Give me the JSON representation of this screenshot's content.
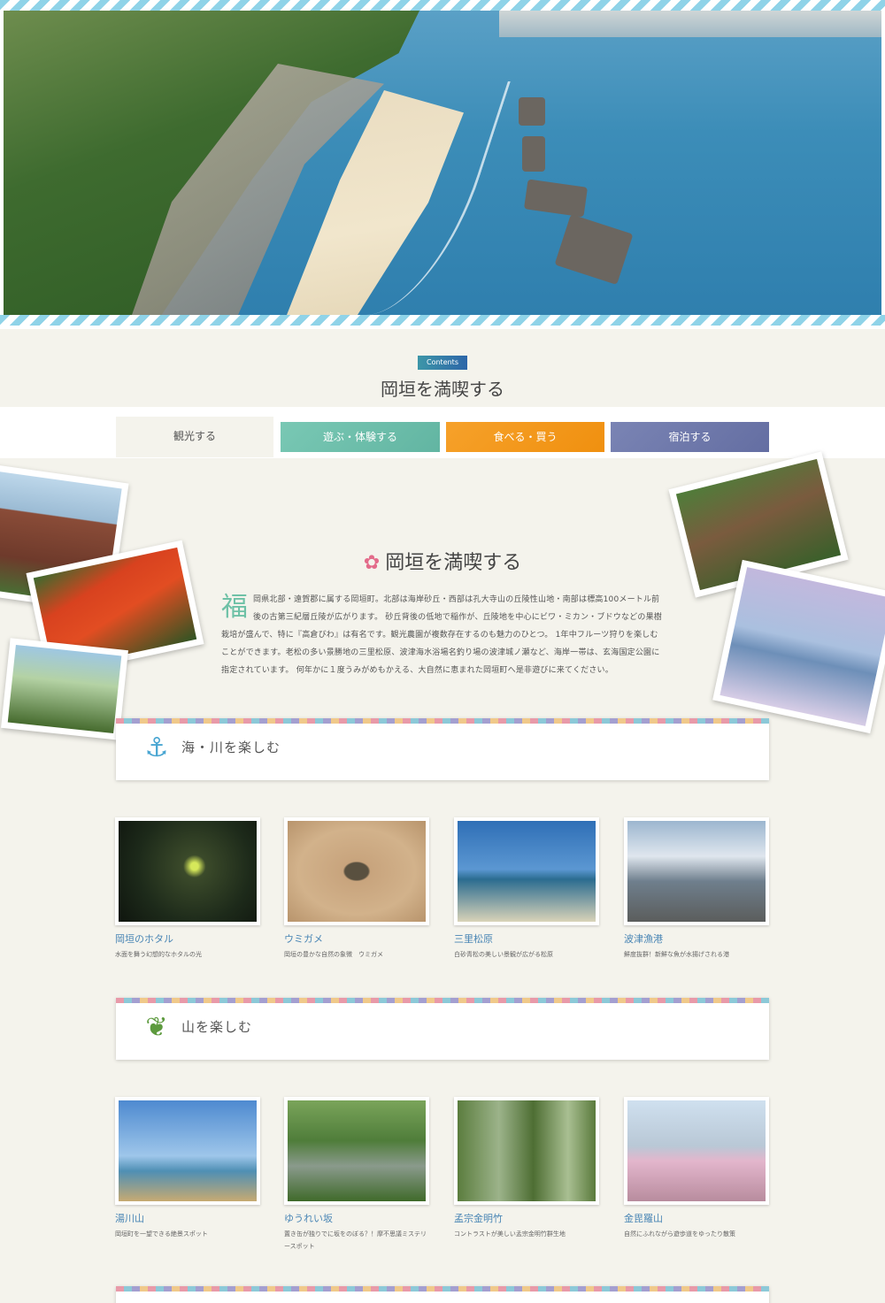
{
  "contents_badge": "Contents",
  "contents_title": "岡垣を満喫する",
  "tabs": [
    {
      "label": "観光する"
    },
    {
      "label": "遊ぶ・体験する"
    },
    {
      "label": "食べる・買う"
    },
    {
      "label": "宿泊する"
    }
  ],
  "intro": {
    "title": "岡垣を満喫する",
    "initial": "福",
    "body": "岡県北部・遠賀郡に属する岡垣町。北部は海岸砂丘・西部は孔大寺山の丘陵性山地・南部は標高100メートル前後の古第三紀層丘陵が広がります。 砂丘背後の低地で稲作が、丘陵地を中心にビワ・ミカン・ブドウなどの果樹栽培が盛んで、特に『高倉びわ』は有名です。観光農園が複数存在するのも魅力のひとつ。 1年中フルーツ狩りを楽しむことができます。老松の多い景勝地の三里松原、波津海水浴場名釣り場の波津城ノ瀬など、海岸一帯は、玄海国定公園に指定されています。 何年かに１度うみがめもかえる、大自然に恵まれた岡垣町へ是非遊びに来てください。"
  },
  "sections": [
    {
      "label": "海・川を楽しむ",
      "icon": "anchor-icon",
      "cards": [
        {
          "name": "岡垣のホタル",
          "desc": "水面を舞う幻想的なホタルの光"
        },
        {
          "name": "ウミガメ",
          "desc": "岡垣の豊かな自然の象徴　ウミガメ"
        },
        {
          "name": "三里松原",
          "desc": "白砂青松の美しい景観が広がる松原"
        },
        {
          "name": "波津漁港",
          "desc": "鮮度抜群！新鮮な魚が水揚げされる港"
        }
      ]
    },
    {
      "label": "山を楽しむ",
      "icon": "tree-icon",
      "cards": [
        {
          "name": "湯川山",
          "desc": "岡垣町を一望できる絶景スポット"
        },
        {
          "name": "ゆうれい坂",
          "desc": "置き缶が独りでに坂をのぼる？！摩不思議ミステリースポット"
        },
        {
          "name": "孟宗金明竹",
          "desc": "コントラストが美しい孟宗金明竹群生地"
        },
        {
          "name": "金毘羅山",
          "desc": "自然にふれながら遊歩道をゆったり散策"
        }
      ]
    }
  ],
  "colors": {
    "background": "#f4f3ec",
    "accent_green": "#6ec1a6",
    "tab_green": "#62b5a2",
    "tab_orange": "#f0900f",
    "tab_purple": "#646ea2",
    "link_blue": "#4a86b5"
  }
}
